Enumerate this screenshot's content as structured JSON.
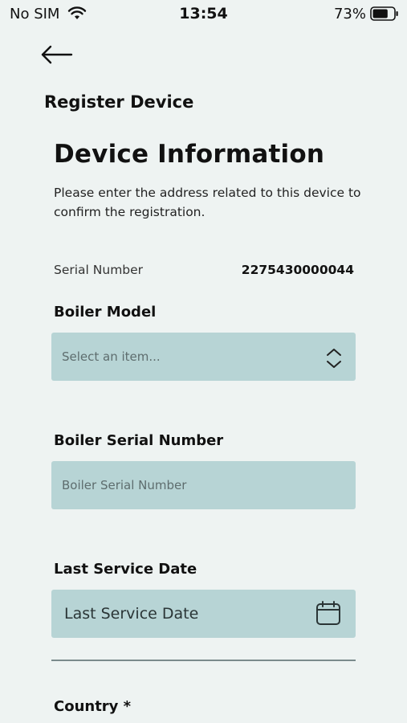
{
  "status_bar": {
    "carrier": "No SIM",
    "time": "13:54",
    "battery_percent": "73%",
    "battery_level": 0.73
  },
  "header": {
    "title": "Register Device"
  },
  "section": {
    "title": "Device Information",
    "intro": "Please enter the address related to this device to confirm the registration."
  },
  "serial": {
    "label": "Serial Number",
    "value": "2275430000044"
  },
  "fields": {
    "boiler_model": {
      "label": "Boiler Model",
      "placeholder": "Select an item..."
    },
    "boiler_serial": {
      "label": "Boiler Serial Number",
      "placeholder": "Boiler Serial Number"
    },
    "last_service": {
      "label": "Last Service Date",
      "placeholder": "Last Service Date"
    },
    "country": {
      "label": "Country *"
    }
  },
  "icons": {
    "back": "arrow-left-icon",
    "select": "chevron-up-down-icon",
    "date": "calendar-icon",
    "wifi": "wifi-icon",
    "battery": "battery-icon"
  },
  "colors": {
    "background": "#eef3f2",
    "field_fill": "#b7d4d5",
    "text": "#111111",
    "divider": "#7b8b8c"
  }
}
